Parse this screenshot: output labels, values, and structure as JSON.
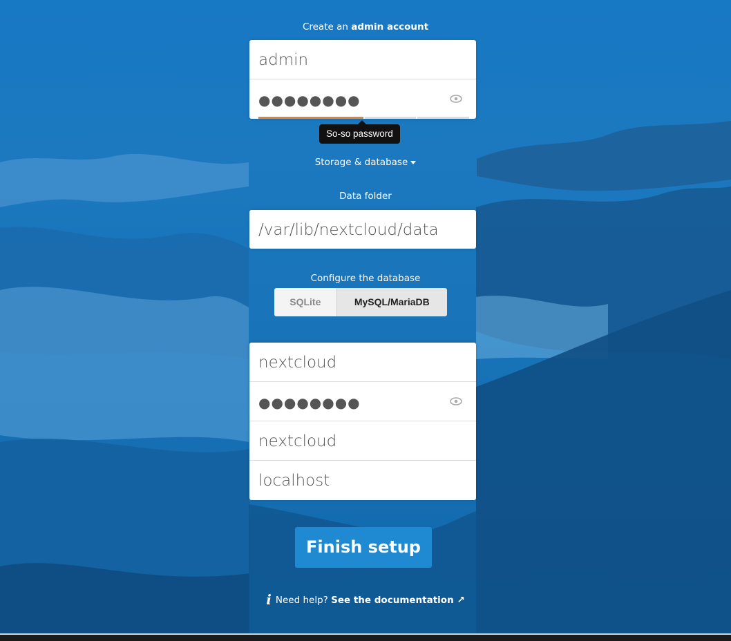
{
  "admin_section": {
    "heading_prefix": "Create an ",
    "heading_bold": "admin account",
    "username_value": "admin",
    "password_dots": "●●●●●●●●",
    "password_strength_tooltip": "So-so password"
  },
  "storage_toggle": {
    "label": "Storage & database"
  },
  "data_folder": {
    "label": "Data folder",
    "value": "/var/lib/nextcloud/data"
  },
  "database": {
    "label": "Configure the database",
    "options": [
      "SQLite",
      "MySQL/MariaDB"
    ],
    "selected": "MySQL/MariaDB",
    "db_user": "nextcloud",
    "db_password_dots": "●●●●●●●●",
    "db_name": "nextcloud",
    "db_host": "localhost"
  },
  "finish_button": {
    "label": "Finish setup"
  },
  "help": {
    "icon": "i",
    "prefix": "Need help? ",
    "link": "See the documentation ↗"
  },
  "colors": {
    "background": "#1a6fb8",
    "primary": "#1f8ad1",
    "strength_fill": "#e9822a"
  }
}
